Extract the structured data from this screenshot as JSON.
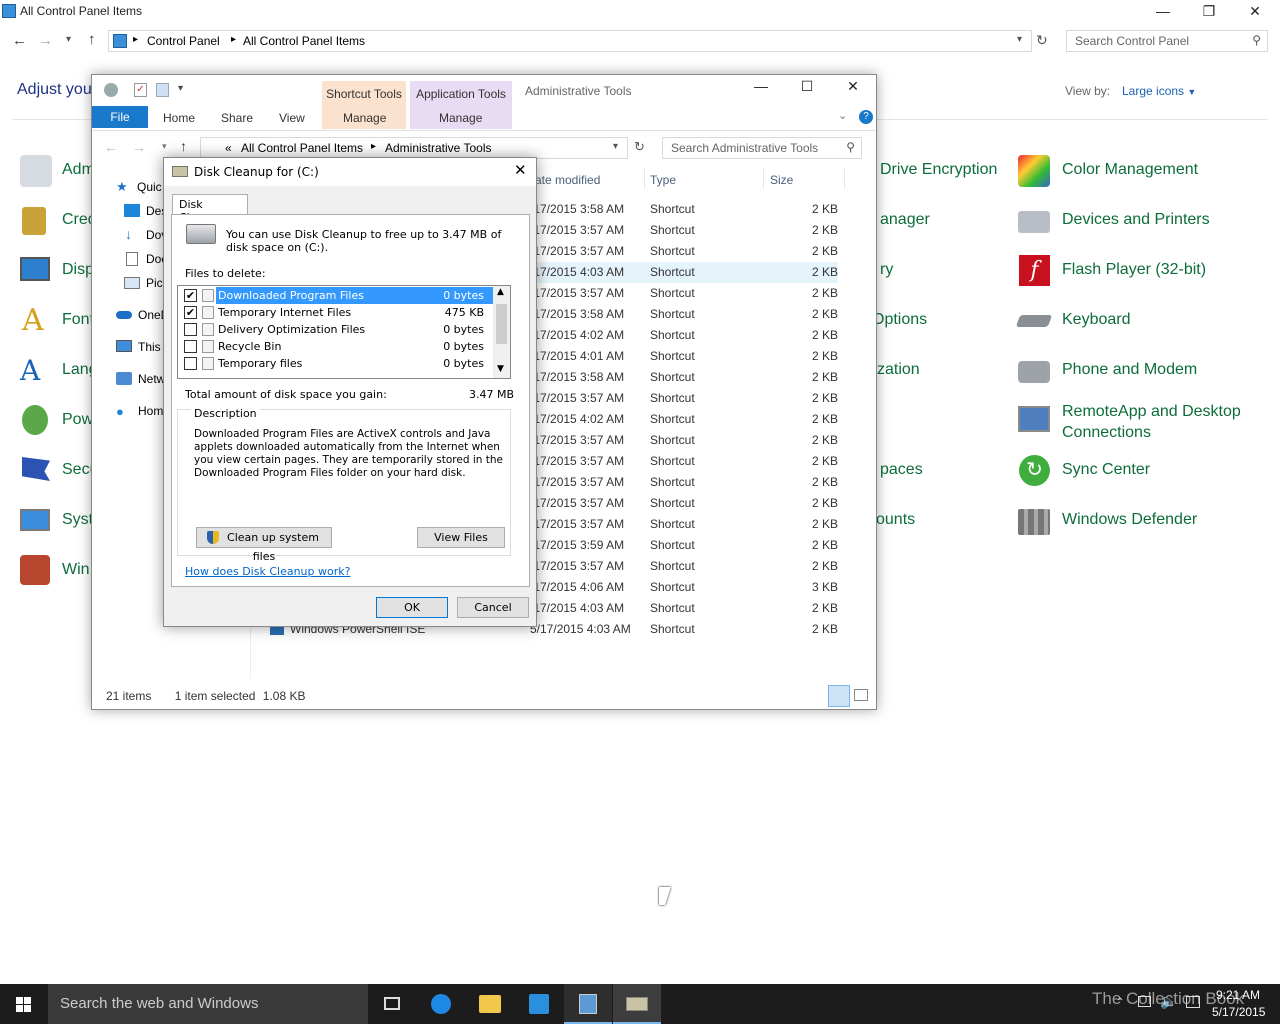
{
  "control_panel": {
    "title": "All Control Panel Items",
    "breadcrumb": [
      "Control Panel",
      "All Control Panel Items"
    ],
    "search_placeholder": "Search Control Panel",
    "heading": "Adjust you",
    "view_by_label": "View by:",
    "view_by_value": "Large icons",
    "items_left": [
      "Adm",
      "Cred",
      "Disp",
      "Font",
      "Lang",
      "Pow",
      "Secu",
      "Syst",
      "Win"
    ],
    "items_middle": [
      "Drive Encryption",
      "anager",
      "ry",
      "Options",
      "zation",
      "paces",
      "ounts"
    ],
    "items_right": [
      "Color Management",
      "Devices and Printers",
      "Flash Player (32-bit)",
      "Keyboard",
      "Phone and Modem",
      "RemoteApp and Desktop Connections",
      "Sync Center",
      "Windows Defender"
    ]
  },
  "explorer": {
    "title": "Administrative Tools",
    "ctx_tabs": [
      "Shortcut Tools",
      "Application Tools"
    ],
    "ribbon_tabs": [
      "File",
      "Home",
      "Share",
      "View",
      "Manage",
      "Manage"
    ],
    "breadcrumb_prefix": "«",
    "breadcrumb": [
      "All Control Panel Items",
      "Administrative Tools"
    ],
    "search_placeholder": "Search Administrative Tools",
    "columns": [
      "ate modified",
      "Type",
      "Size"
    ],
    "nav_items": [
      "Quic",
      "Des",
      "Dov",
      "Doc",
      "Pict",
      "OneD",
      "This",
      "Netw",
      "Hom"
    ],
    "rows": [
      {
        "date": "/17/2015 3:58 AM",
        "type": "Shortcut",
        "size": "2 KB"
      },
      {
        "date": "/17/2015 3:57 AM",
        "type": "Shortcut",
        "size": "2 KB"
      },
      {
        "date": "/17/2015 3:57 AM",
        "type": "Shortcut",
        "size": "2 KB"
      },
      {
        "date": "/17/2015 4:03 AM",
        "type": "Shortcut",
        "size": "2 KB"
      },
      {
        "date": "/17/2015 3:57 AM",
        "type": "Shortcut",
        "size": "2 KB"
      },
      {
        "date": "/17/2015 3:58 AM",
        "type": "Shortcut",
        "size": "2 KB"
      },
      {
        "date": "/17/2015 4:02 AM",
        "type": "Shortcut",
        "size": "2 KB"
      },
      {
        "date": "/17/2015 4:01 AM",
        "type": "Shortcut",
        "size": "2 KB"
      },
      {
        "date": "/17/2015 3:58 AM",
        "type": "Shortcut",
        "size": "2 KB"
      },
      {
        "date": "/17/2015 3:57 AM",
        "type": "Shortcut",
        "size": "2 KB"
      },
      {
        "date": "/17/2015 4:02 AM",
        "type": "Shortcut",
        "size": "2 KB"
      },
      {
        "date": "/17/2015 3:57 AM",
        "type": "Shortcut",
        "size": "2 KB"
      },
      {
        "date": "/17/2015 3:57 AM",
        "type": "Shortcut",
        "size": "2 KB"
      },
      {
        "date": "/17/2015 3:57 AM",
        "type": "Shortcut",
        "size": "2 KB"
      },
      {
        "date": "/17/2015 3:57 AM",
        "type": "Shortcut",
        "size": "2 KB"
      },
      {
        "date": "/17/2015 3:57 AM",
        "type": "Shortcut",
        "size": "2 KB"
      },
      {
        "date": "/17/2015 3:59 AM",
        "type": "Shortcut",
        "size": "2 KB"
      },
      {
        "date": "/17/2015 3:57 AM",
        "type": "Shortcut",
        "size": "2 KB"
      },
      {
        "date": "/17/2015 4:06 AM",
        "type": "Shortcut",
        "size": "3 KB"
      },
      {
        "date": "/17/2015 4:03 AM",
        "type": "Shortcut",
        "size": "2 KB"
      },
      {
        "name": "Windows PowerShell ISE",
        "date": "5/17/2015 4:03 AM",
        "type": "Shortcut",
        "size": "2 KB"
      }
    ],
    "status_count": "21 items",
    "status_selected": "1 item selected",
    "status_size": "1.08 KB"
  },
  "disk_cleanup": {
    "title": "Disk Cleanup for  (C:)",
    "tab": "Disk Cleanup",
    "intro": "You can use Disk Cleanup to free up to 3.47 MB of disk space on  (C:).",
    "files_label": "Files to delete:",
    "files": [
      {
        "name": "Downloaded Program Files",
        "size": "0 bytes",
        "checked": true,
        "selected": true
      },
      {
        "name": "Temporary Internet Files",
        "size": "475 KB",
        "checked": true,
        "selected": false
      },
      {
        "name": "Delivery Optimization Files",
        "size": "0 bytes",
        "checked": false,
        "selected": false
      },
      {
        "name": "Recycle Bin",
        "size": "0 bytes",
        "checked": false,
        "selected": false
      },
      {
        "name": "Temporary files",
        "size": "0 bytes",
        "checked": false,
        "selected": false
      }
    ],
    "total_label": "Total amount of disk space you gain:",
    "total_value": "3.47 MB",
    "description_label": "Description",
    "description": "Downloaded Program Files are ActiveX controls and Java applets downloaded automatically from the Internet when you view certain pages. They are temporarily stored in the Downloaded Program Files folder on your hard disk.",
    "cleanup_system_label": "Clean up system files",
    "view_files_label": "View Files",
    "help_link": "How does Disk Cleanup work?",
    "ok_label": "OK",
    "cancel_label": "Cancel"
  },
  "taskbar": {
    "search_placeholder": "Search the web and Windows",
    "watermark": "The Collection Book",
    "time": "9:21 AM",
    "date": "5/17/2015"
  }
}
